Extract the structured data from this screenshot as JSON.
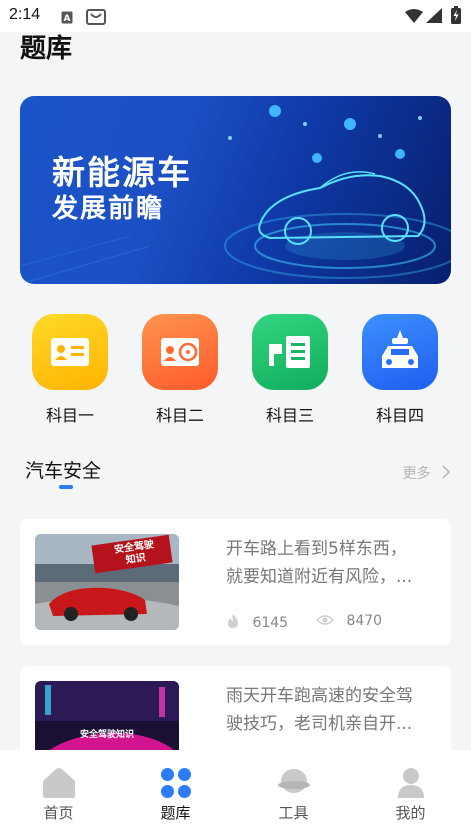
{
  "status_bar": {
    "time": "2:14"
  },
  "page": {
    "title": "题库"
  },
  "banner": {
    "title_line1": "新能源车",
    "title_line2": "发展前瞻"
  },
  "subjects": [
    {
      "label": "科目一",
      "color_from": "#ffd21f",
      "color_to": "#ffb300",
      "icon": "id-card-icon"
    },
    {
      "label": "科目二",
      "color_from": "#ff8a4a",
      "color_to": "#ff5a2a",
      "icon": "steering-license-icon"
    },
    {
      "label": "科目三",
      "color_from": "#2fd07a",
      "color_to": "#12b260",
      "icon": "route-checklist-icon"
    },
    {
      "label": "科目四",
      "color_from": "#3b8cff",
      "color_to": "#1f5ef0",
      "icon": "police-car-icon"
    }
  ],
  "section": {
    "title": "汽车安全",
    "more_label": "更多",
    "accent": "#2b7cf6"
  },
  "articles": [
    {
      "title_line1": "开车路上看到5样东西，",
      "title_line2": "就要知道附近有风险，...",
      "likes": "6145",
      "views": "8470",
      "thumb_caption_line1": "安全驾驶",
      "thumb_caption_line2": "知识"
    },
    {
      "title_line1": "雨天开车跑高速的安全驾",
      "title_line2": "驶技巧，老司机亲自开...",
      "likes": "",
      "views": "",
      "thumb_caption_line1": "安全驾驶知识",
      "thumb_caption_line2": ""
    }
  ],
  "tab_bar": {
    "active_color": "#2b7cf6",
    "tabs": [
      {
        "label": "首页",
        "icon": "home-icon"
      },
      {
        "label": "题库",
        "icon": "question-bank-icon"
      },
      {
        "label": "工具",
        "icon": "tools-icon"
      },
      {
        "label": "我的",
        "icon": "profile-icon"
      }
    ]
  }
}
